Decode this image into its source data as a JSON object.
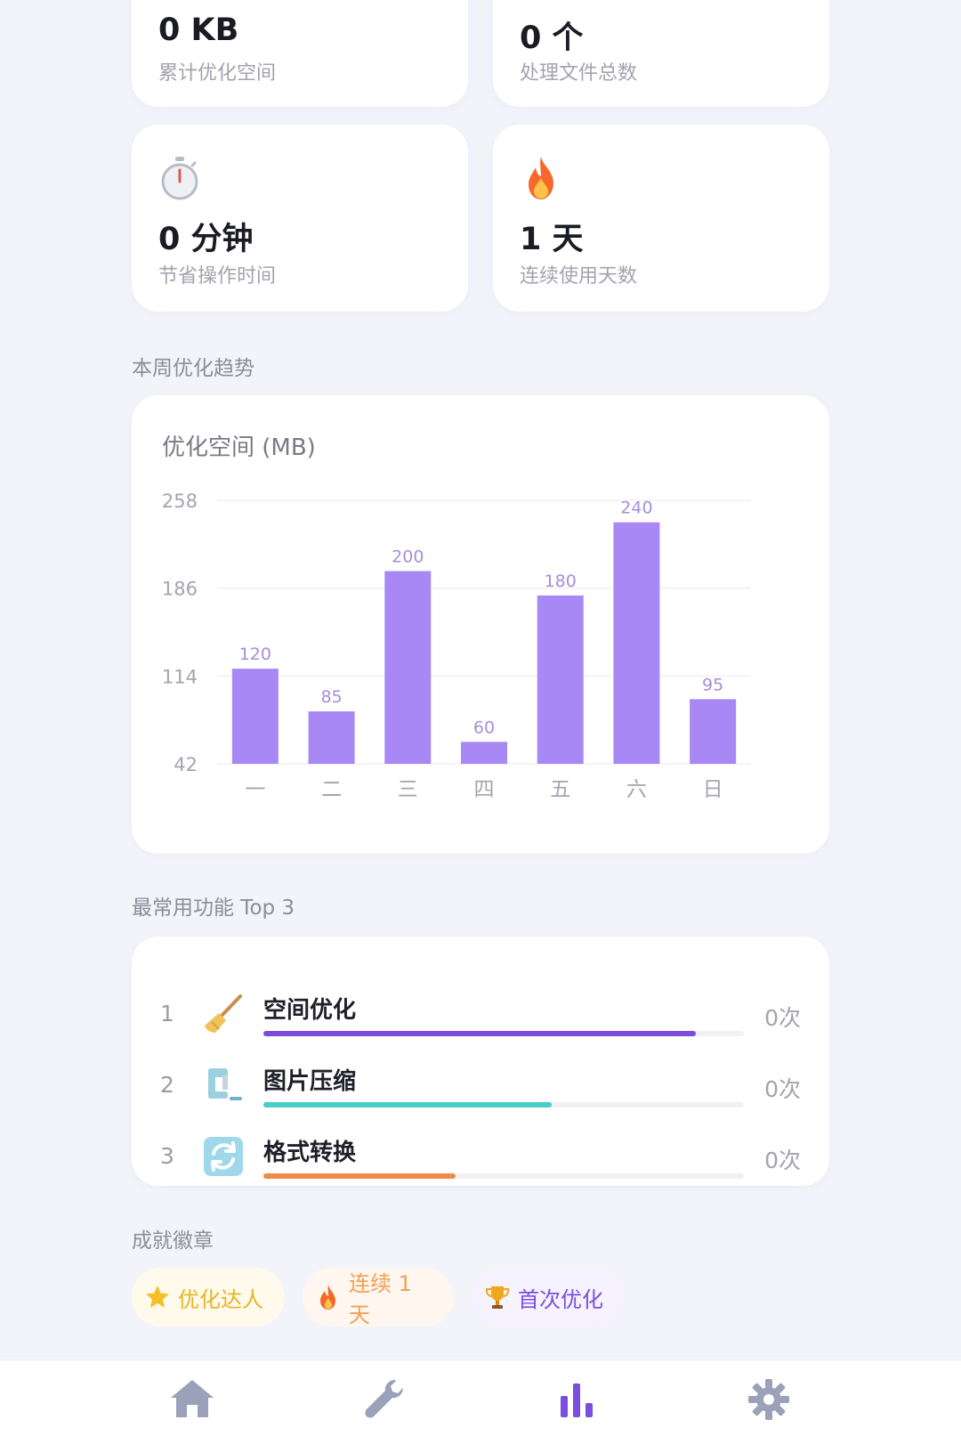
{
  "stats": {
    "saved_space": {
      "value": "0 KB",
      "label": "累计优化空间"
    },
    "files": {
      "value": "0 个",
      "label": "处理文件总数"
    },
    "time_saved": {
      "value": "0 分钟",
      "label": "节省操作时间",
      "icon": "stopwatch-icon"
    },
    "streak": {
      "value": "1 天",
      "label": "连续使用天数",
      "icon": "fire-icon"
    }
  },
  "trend": {
    "section_title": "本周优化趋势",
    "chart_title": "优化空间 (MB)"
  },
  "chart_data": {
    "type": "bar",
    "title": "优化空间 (MB)",
    "categories": [
      "一",
      "二",
      "三",
      "四",
      "五",
      "六",
      "日"
    ],
    "values": [
      120,
      85,
      200,
      60,
      180,
      240,
      95
    ],
    "yticks": [
      42,
      114,
      186,
      258
    ],
    "ylim": [
      42,
      258
    ],
    "grid": true,
    "color": "#a888f4"
  },
  "top_features": {
    "section_title": "最常用功能 Top 3",
    "items": [
      {
        "rank": "1",
        "name": "空间优化",
        "count": "0次",
        "icon": "broom-icon",
        "color": "#7b4be0",
        "fill": 0.9
      },
      {
        "rank": "2",
        "name": "图片压缩",
        "count": "0次",
        "icon": "clamp-icon",
        "color": "#45cdc6",
        "fill": 0.6
      },
      {
        "rank": "3",
        "name": "格式转换",
        "count": "0次",
        "icon": "convert-icon",
        "color": "#f08a47",
        "fill": 0.4
      }
    ]
  },
  "badges": {
    "section_title": "成就徽章",
    "items": [
      {
        "label": "优化达人",
        "icon": "star-icon",
        "color": "#e9b422",
        "bg": "#fffaec"
      },
      {
        "label": "连续 1 天",
        "icon": "fire-icon",
        "color": "#f0a053",
        "bg": "#fff6ef"
      },
      {
        "label": "首次优化",
        "icon": "trophy-icon",
        "color": "#7c4ee0",
        "bg": "#f6f2ff"
      }
    ]
  },
  "nav": {
    "items": [
      {
        "icon": "home-icon",
        "active": false
      },
      {
        "icon": "wrench-icon",
        "active": false
      },
      {
        "icon": "bar-chart-icon",
        "active": true
      },
      {
        "icon": "gear-icon",
        "active": false
      }
    ]
  }
}
